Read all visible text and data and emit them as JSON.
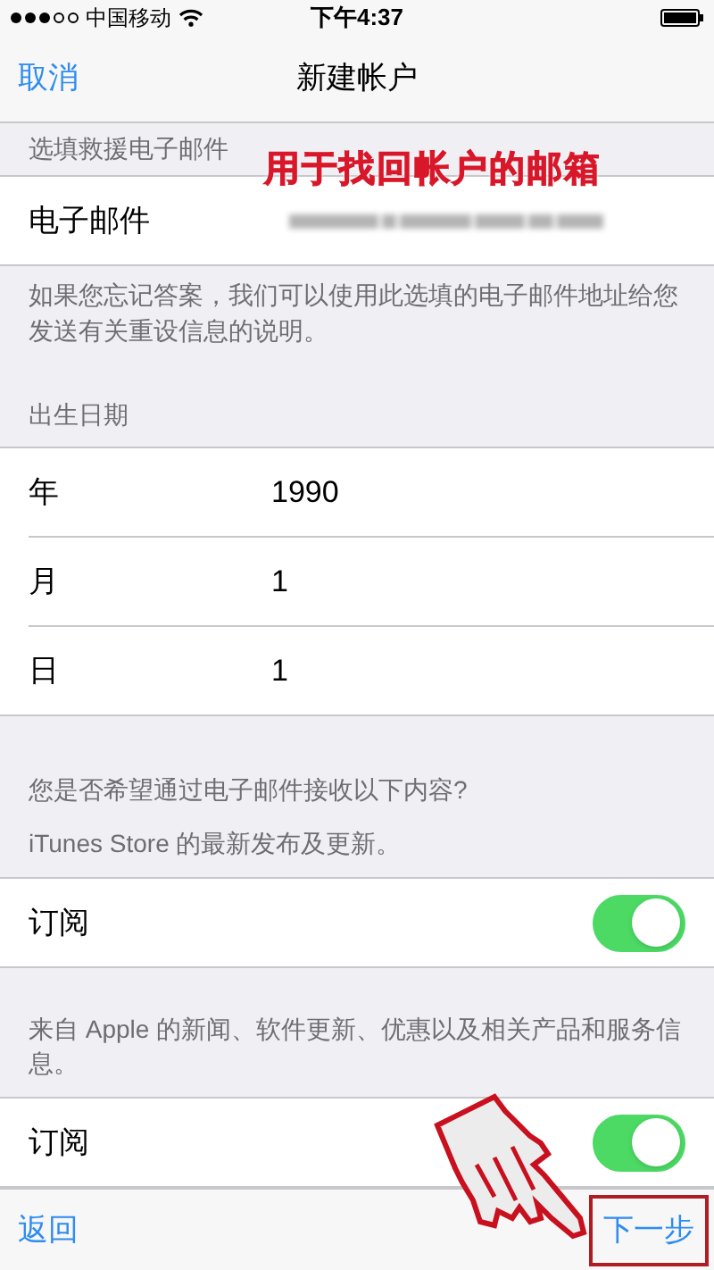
{
  "status_bar": {
    "carrier": "中国移动",
    "time": "下午4:37"
  },
  "nav": {
    "cancel": "取消",
    "title": "新建帐户"
  },
  "annotation": "用于找回帐户的邮箱",
  "email_section": {
    "header": "选填救援电子邮件",
    "label": "电子邮件",
    "footer": "如果您忘记答案，我们可以使用此选填的电子邮件地址给您发送有关重设信息的说明。"
  },
  "birth_section": {
    "header": "出生日期",
    "rows": [
      {
        "label": "年",
        "value": "1990"
      },
      {
        "label": "月",
        "value": "1"
      },
      {
        "label": "日",
        "value": "1"
      }
    ]
  },
  "subscriptions": [
    {
      "intro": "您是否希望通过电子邮件接收以下内容?",
      "description": "iTunes Store 的最新发布及更新。",
      "label": "订阅",
      "on": true
    },
    {
      "description": "来自 Apple 的新闻、软件更新、优惠以及相关产品和服务信息。",
      "label": "订阅",
      "on": true
    }
  ],
  "toolbar": {
    "back": "返回",
    "next": "下一步",
    "next_highlighted": true
  }
}
